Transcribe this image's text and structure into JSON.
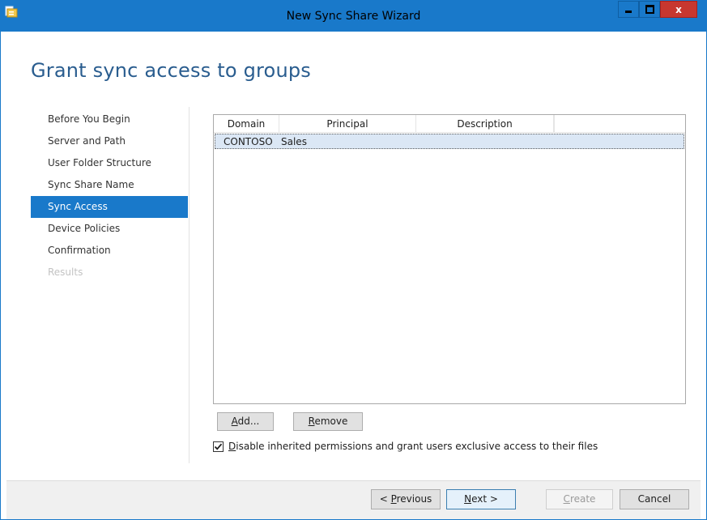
{
  "window": {
    "title": "New Sync Share Wizard",
    "close_glyph": "x"
  },
  "page": {
    "title": "Grant sync access to groups"
  },
  "nav": {
    "items": [
      {
        "label": "Before You Begin",
        "state": "normal"
      },
      {
        "label": "Server and Path",
        "state": "normal"
      },
      {
        "label": "User Folder Structure",
        "state": "normal"
      },
      {
        "label": "Sync Share Name",
        "state": "normal"
      },
      {
        "label": "Sync Access",
        "state": "active"
      },
      {
        "label": "Device Policies",
        "state": "normal"
      },
      {
        "label": "Confirmation",
        "state": "normal"
      },
      {
        "label": "Results",
        "state": "disabled"
      }
    ]
  },
  "table": {
    "columns": [
      "Domain",
      "Principal",
      "Description"
    ],
    "rows": [
      {
        "domain": "CONTOSO",
        "principal": "Sales",
        "description": ""
      }
    ]
  },
  "buttons": {
    "add_access_key": "A",
    "add_rest": "dd...",
    "remove_access_key": "R",
    "remove_rest": "emove"
  },
  "checkbox": {
    "checked": true,
    "label_access_key": "D",
    "label_rest": "isable inherited permissions and grant users exclusive access to their files"
  },
  "footer": {
    "prev_prefix": "< ",
    "prev_access_key": "P",
    "prev_rest": "revious",
    "next_access_key": "N",
    "next_rest": "ext >",
    "create_access_key": "C",
    "create_rest": "reate",
    "cancel_label": "Cancel"
  },
  "colors": {
    "accent": "#1979ca",
    "title_text": "#2a5d8f",
    "selection": "#dbe7f5",
    "close_button": "#c7372f"
  },
  "icons": {
    "app": "sync-share-app-icon",
    "minimize": "minimize-icon",
    "maximize": "maximize-icon",
    "close": "close-icon",
    "check": "checkmark-icon"
  }
}
